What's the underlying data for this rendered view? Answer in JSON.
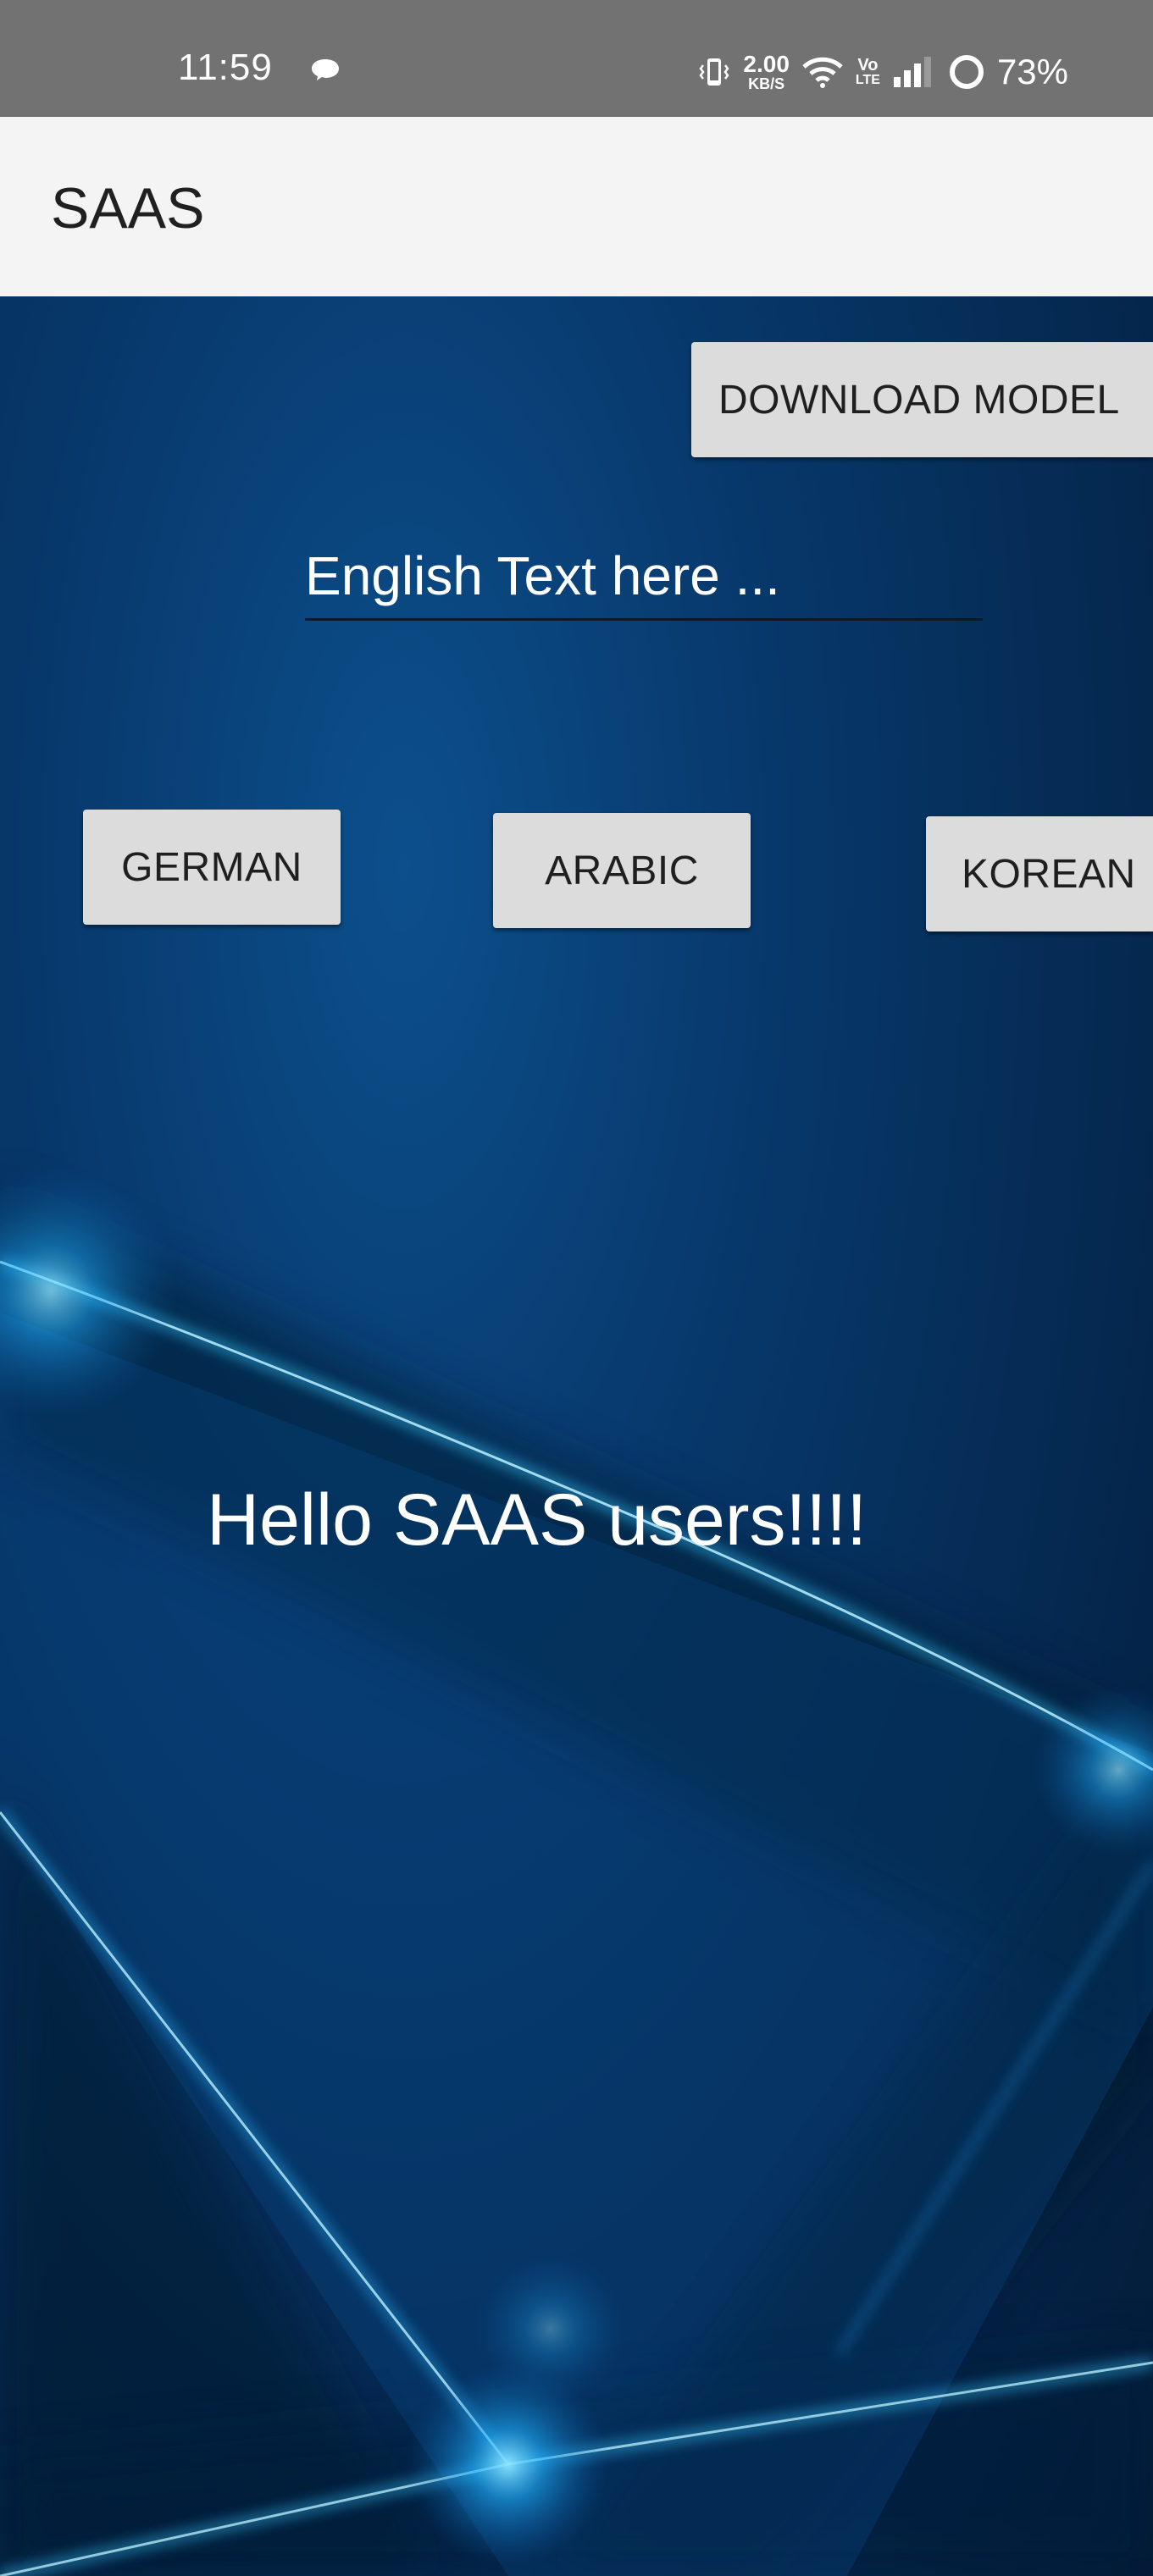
{
  "status_bar": {
    "time": "11:59",
    "net_speed_value": "2.00",
    "net_speed_unit": "KB/S",
    "volte_top": "Vo",
    "volte_bottom": "LTE",
    "battery": "73%"
  },
  "app_bar": {
    "title": "SAAS"
  },
  "main": {
    "download_button": "DOWNLOAD MODEL",
    "input_placeholder": "English Text here ...",
    "buttons": [
      "GERMAN",
      "ARABIC",
      "KOREAN"
    ],
    "output_text": "Hello SAAS users!!!!"
  },
  "colors": {
    "status_bar_bg": "#727272",
    "app_bar_bg": "#f4f4f4",
    "button_bg": "#dcdcdc",
    "background_blue": "#07386b",
    "glow_cyan": "#35c8ff"
  },
  "icons": [
    "chat-bubble-icon",
    "vibrate-icon",
    "wifi-icon",
    "signal-icon",
    "battery-ring-icon"
  ]
}
